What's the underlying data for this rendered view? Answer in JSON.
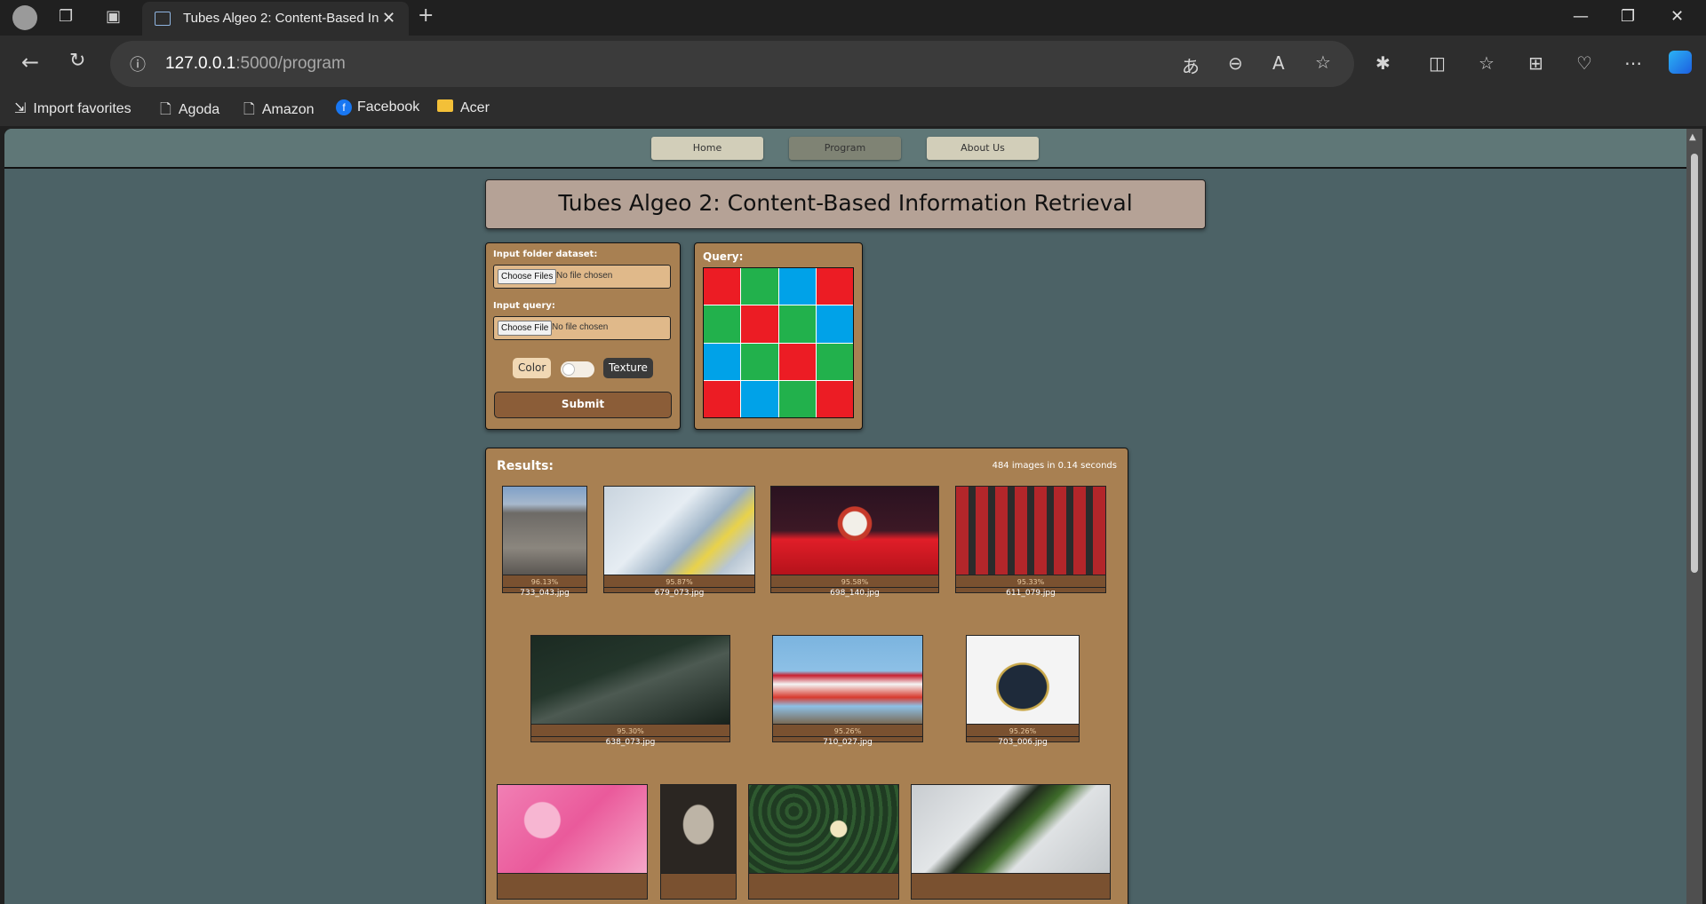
{
  "browser": {
    "tab_title": "Tubes Algeo 2: Content-Based Information Retrieval",
    "url_host": "127.0.0.1",
    "url_path": ":5000/program",
    "favorites": [
      {
        "label": "Import favorites",
        "icon": "import-icon"
      },
      {
        "label": "Agoda",
        "icon": "page-icon"
      },
      {
        "label": "Amazon",
        "icon": "page-icon"
      },
      {
        "label": "Facebook",
        "icon": "facebook-icon"
      },
      {
        "label": "Acer",
        "icon": "folder-icon"
      }
    ]
  },
  "nav": {
    "home": "Home",
    "program": "Program",
    "about": "About Us",
    "active": "Program"
  },
  "page_title": "Tubes Algeo 2: Content-Based Information Retrieval",
  "input_panel": {
    "dataset_label": "Input folder dataset:",
    "dataset_button": "Choose Files",
    "dataset_status": "No file chosen",
    "query_label": "Input query:",
    "query_button": "Choose File",
    "query_status": "No file chosen",
    "toggle_left": "Color",
    "toggle_right": "Texture",
    "toggle_state": "off",
    "submit": "Submit"
  },
  "query_panel": {
    "label": "Query:",
    "grid_colors": [
      "#ec1c24",
      "#22b14c",
      "#00a2e8",
      "#ec1c24",
      "#22b14c",
      "#ec1c24",
      "#22b14c",
      "#00a2e8",
      "#00a2e8",
      "#22b14c",
      "#ec1c24",
      "#22b14c",
      "#ec1c24",
      "#00a2e8",
      "#22b14c",
      "#ec1c24"
    ]
  },
  "results": {
    "title": "Results:",
    "summary": "484 images in 0.14 seconds",
    "items": [
      {
        "similarity": "96.13%",
        "filename": "733_043.jpg"
      },
      {
        "similarity": "95.87%",
        "filename": "679_073.jpg"
      },
      {
        "similarity": "95.58%",
        "filename": "698_140.jpg"
      },
      {
        "similarity": "95.33%",
        "filename": "611_079.jpg"
      },
      {
        "similarity": "95.30%",
        "filename": "638_073.jpg"
      },
      {
        "similarity": "95.26%",
        "filename": "710_027.jpg"
      },
      {
        "similarity": "95.26%",
        "filename": "703_006.jpg"
      }
    ]
  },
  "colors": {
    "page_bg": "#4c6266",
    "navbar_bg": "#5f7777",
    "panel_bg": "#a88052",
    "title_bg": "#b5a296",
    "submit_bg": "#8b5d38"
  }
}
